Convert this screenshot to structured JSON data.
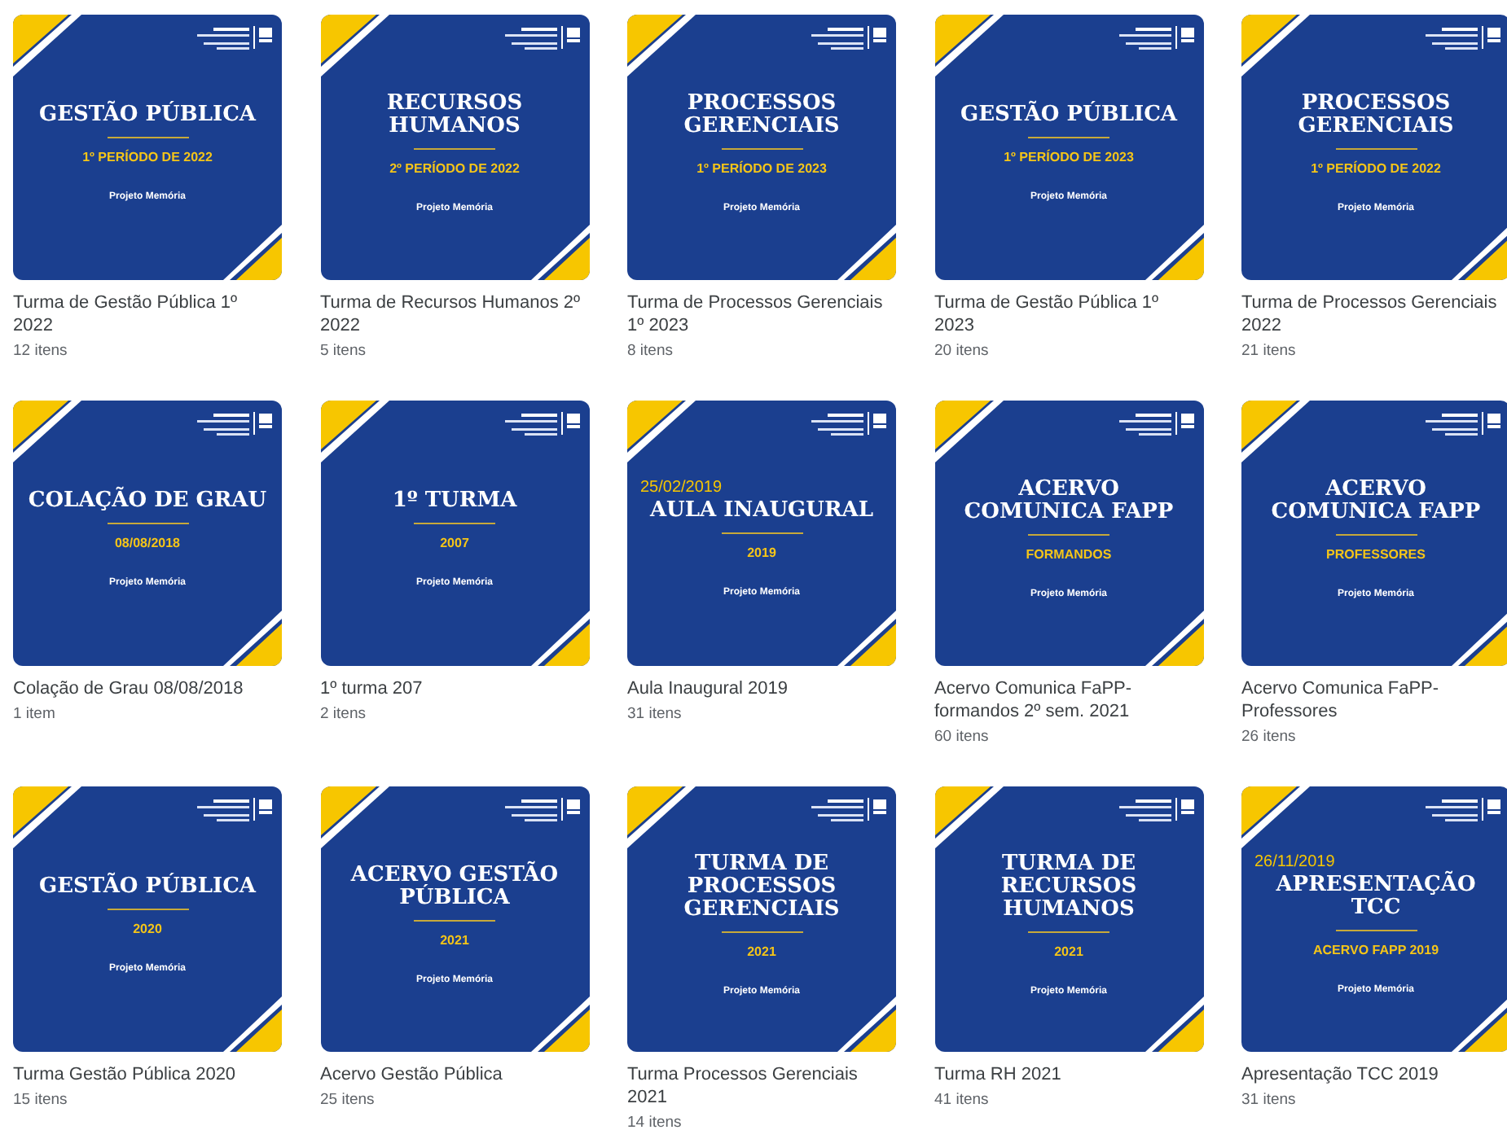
{
  "albums": [
    {
      "cover": {
        "title": "GESTÃO PÚBLICA",
        "subtitle": "1º PERÍODO DE 2022",
        "footer": "Projeto Memória"
      },
      "name": "Turma de Gestão Pública 1º 2022",
      "count": "12 itens"
    },
    {
      "cover": {
        "title": "RECURSOS HUMANOS",
        "subtitle": "2º PERÍODO DE 2022",
        "footer": "Projeto Memória"
      },
      "name": "Turma de Recursos Humanos 2º 2022",
      "count": "5 itens"
    },
    {
      "cover": {
        "title": "PROCESSOS GERENCIAIS",
        "subtitle": "1º PERÍODO DE 2023",
        "footer": "Projeto Memória"
      },
      "name": "Turma de Processos Gerenciais 1º 2023",
      "count": "8 itens"
    },
    {
      "cover": {
        "title": "GESTÃO PÚBLICA",
        "subtitle": "1º PERÍODO DE 2023",
        "footer": "Projeto Memória"
      },
      "name": "Turma de Gestão Pública 1º 2023",
      "count": "20 itens"
    },
    {
      "cover": {
        "title": "PROCESSOS GERENCIAIS",
        "subtitle": "1º PERÍODO DE 2022",
        "footer": "Projeto Memória"
      },
      "name": "Turma de Processos Gerenciais 2022",
      "count": "21 itens"
    },
    {
      "cover": {
        "title": "COLAÇÃO DE GRAU",
        "subtitle": "08/08/2018",
        "footer": "Projeto Memória"
      },
      "name": "Colação de Grau 08/08/2018",
      "count": "1 item"
    },
    {
      "cover": {
        "title": "1º TURMA",
        "subtitle": "2007",
        "footer": "Projeto Memória"
      },
      "name": "1º turma 207",
      "count": "2 itens"
    },
    {
      "cover": {
        "date": "25/02/2019",
        "title": "AULA INAUGURAL",
        "subtitle": "2019",
        "footer": "Projeto Memória"
      },
      "name": "Aula Inaugural 2019",
      "count": "31 itens"
    },
    {
      "cover": {
        "title": "ACERVO COMUNICA FAPP",
        "subtitle": "FORMANDOS",
        "footer": "Projeto Memória"
      },
      "name": "Acervo Comunica FaPP-formandos 2º sem. 2021",
      "count": "60 itens"
    },
    {
      "cover": {
        "title": "ACERVO COMUNICA FAPP",
        "subtitle": "PROFESSORES",
        "footer": "Projeto Memória"
      },
      "name": "Acervo Comunica FaPP-Professores",
      "count": "26 itens"
    },
    {
      "cover": {
        "title": "GESTÃO PÚBLICA",
        "subtitle": "2020",
        "footer": "Projeto Memória"
      },
      "name": "Turma Gestão Pública 2020",
      "count": "15 itens"
    },
    {
      "cover": {
        "title": "ACERVO GESTÃO PÚBLICA",
        "subtitle": "2021",
        "footer": "Projeto Memória"
      },
      "name": "Acervo Gestão Pública",
      "count": "25 itens"
    },
    {
      "cover": {
        "title": "TURMA DE PROCESSOS GERENCIAIS",
        "subtitle": "2021",
        "footer": "Projeto Memória"
      },
      "name": "Turma Processos Gerenciais 2021",
      "count": "14 itens"
    },
    {
      "cover": {
        "title": "TURMA DE RECURSOS HUMANOS",
        "subtitle": "2021",
        "footer": "Projeto Memória"
      },
      "name": "Turma RH 2021",
      "count": "41 itens"
    },
    {
      "cover": {
        "date": "26/11/2019",
        "title": "APRESENTAÇÃO TCC",
        "subtitle": "ACERVO FAPP 2019",
        "footer": "Projeto Memória"
      },
      "name": "Apresentação TCC 2019",
      "count": "31 itens"
    }
  ]
}
